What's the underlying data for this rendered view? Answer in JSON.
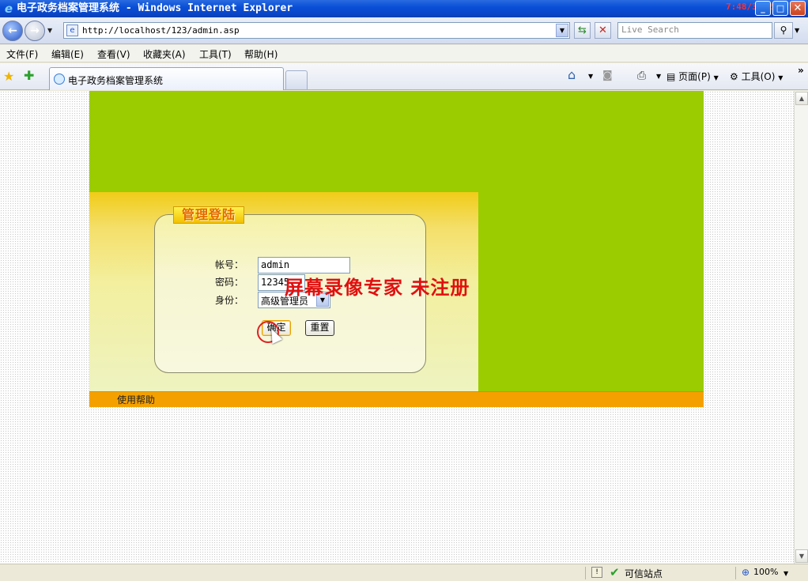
{
  "window": {
    "title": "电子政务档案管理系统 - Windows Internet Explorer",
    "clock": "7:48/3:32",
    "icons": {
      "app": "ie-logo-icon",
      "min": "minimize-icon",
      "max": "maximize-icon",
      "close": "close-icon"
    }
  },
  "address_bar": {
    "url": "http://localhost/123/admin.asp",
    "search_placeholder": "Live Search"
  },
  "menu": {
    "items": [
      "文件(F)",
      "编辑(E)",
      "查看(V)",
      "收藏夹(A)",
      "工具(T)",
      "帮助(H)"
    ]
  },
  "tabs": [
    {
      "label": "电子政务档案管理系统"
    }
  ],
  "command_bar": {
    "page_label": "页面(P)",
    "tools_label": "工具(O)"
  },
  "page": {
    "login_title": "管理登陆",
    "username_label": "帐号：",
    "username_value": "admin",
    "password_label": "密码：",
    "password_value": "12345",
    "role_label": "身份：",
    "role_value": "高级管理员",
    "ok_button": "确定",
    "reset_button": "重置",
    "help_link": "使用帮助",
    "watermark": "屏幕录像专家  未注册"
  },
  "colors": {
    "green": "#9acc00",
    "orange": "#f4a100",
    "watermark": "#e01010"
  },
  "status_bar": {
    "zone": "可信站点",
    "zoom": "100%"
  }
}
